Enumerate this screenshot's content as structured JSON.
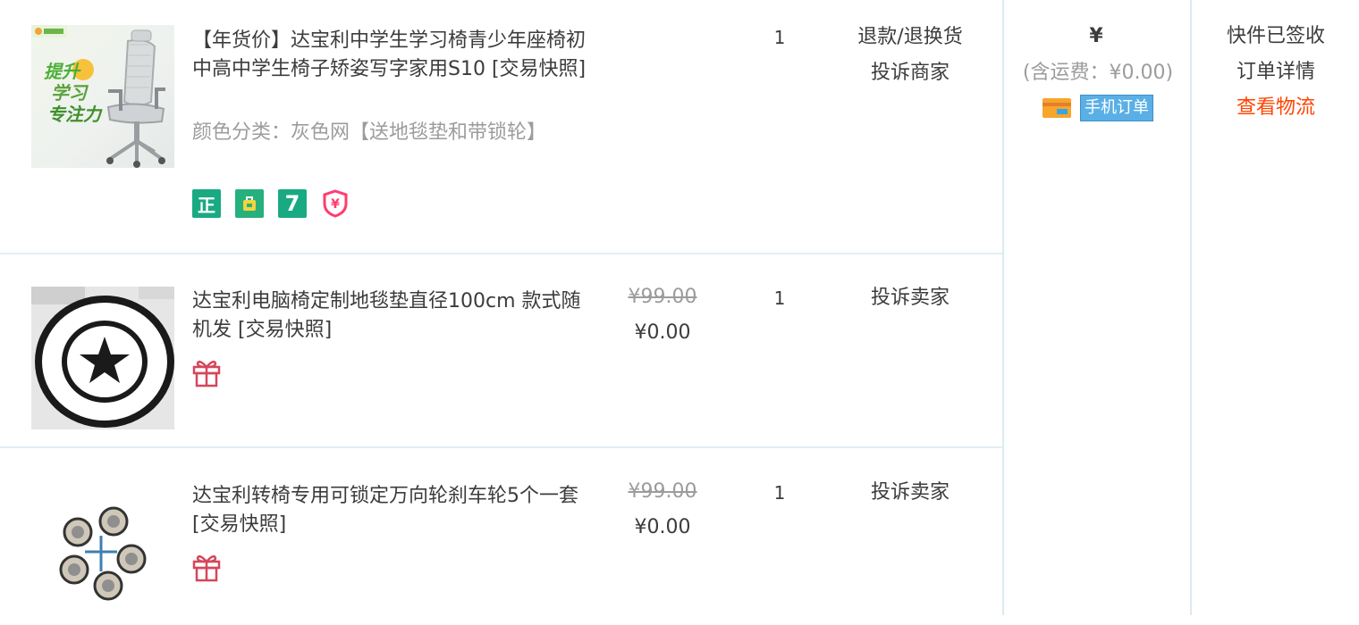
{
  "items": [
    {
      "title": "【年货价】达宝利中学生学习椅青少年座椅初中高中学生椅子矫姿写字家用S10",
      "snapshot": "[交易快照]",
      "sku_label": "颜色分类：灰色网【送地毯垫和带锁轮】",
      "quantity": "1",
      "ops": [
        "退款/退换货",
        "投诉商家"
      ],
      "thumb_text": [
        "提升",
        "学习",
        "专注力"
      ],
      "badges": [
        {
          "icon": "genuine-icon",
          "glyph": "正",
          "color": "#1aaa83"
        },
        {
          "icon": "bag-icon",
          "glyph": "",
          "color": "#26b07d"
        },
        {
          "icon": "seven-day-return-icon",
          "glyph": "7",
          "color": "#1aaa83"
        },
        {
          "icon": "yen-shield-icon",
          "glyph": "¥",
          "color": "#ff3d6e"
        }
      ]
    },
    {
      "title": "达宝利电脑椅定制地毯垫直径100cm 款式随机发",
      "snapshot": "[交易快照]",
      "price_original": "¥99.00",
      "price_now": "¥0.00",
      "quantity": "1",
      "ops": [
        "投诉卖家"
      ],
      "gift_icon": "gift-icon"
    },
    {
      "title": "达宝利转椅专用可锁定万向轮刹车轮5个一套",
      "snapshot": "[交易快照]",
      "price_original": "¥99.00",
      "price_now": "¥0.00",
      "quantity": "1",
      "ops": [
        "投诉卖家"
      ],
      "gift_icon": "gift-icon"
    }
  ],
  "total": {
    "currency": "¥",
    "shipping_note": "(含运费：¥0.00)",
    "card_icon": "card-icon",
    "mobile_order_badge": "手机订单"
  },
  "status": {
    "delivery_status": "快件已签收",
    "order_detail_link": "订单详情",
    "logistics_link": "查看物流"
  },
  "colors": {
    "accent_link": "#ff4400",
    "divider": "#e3eef4",
    "badge_green": "#1aaa83",
    "gift_red": "#d6465a"
  }
}
